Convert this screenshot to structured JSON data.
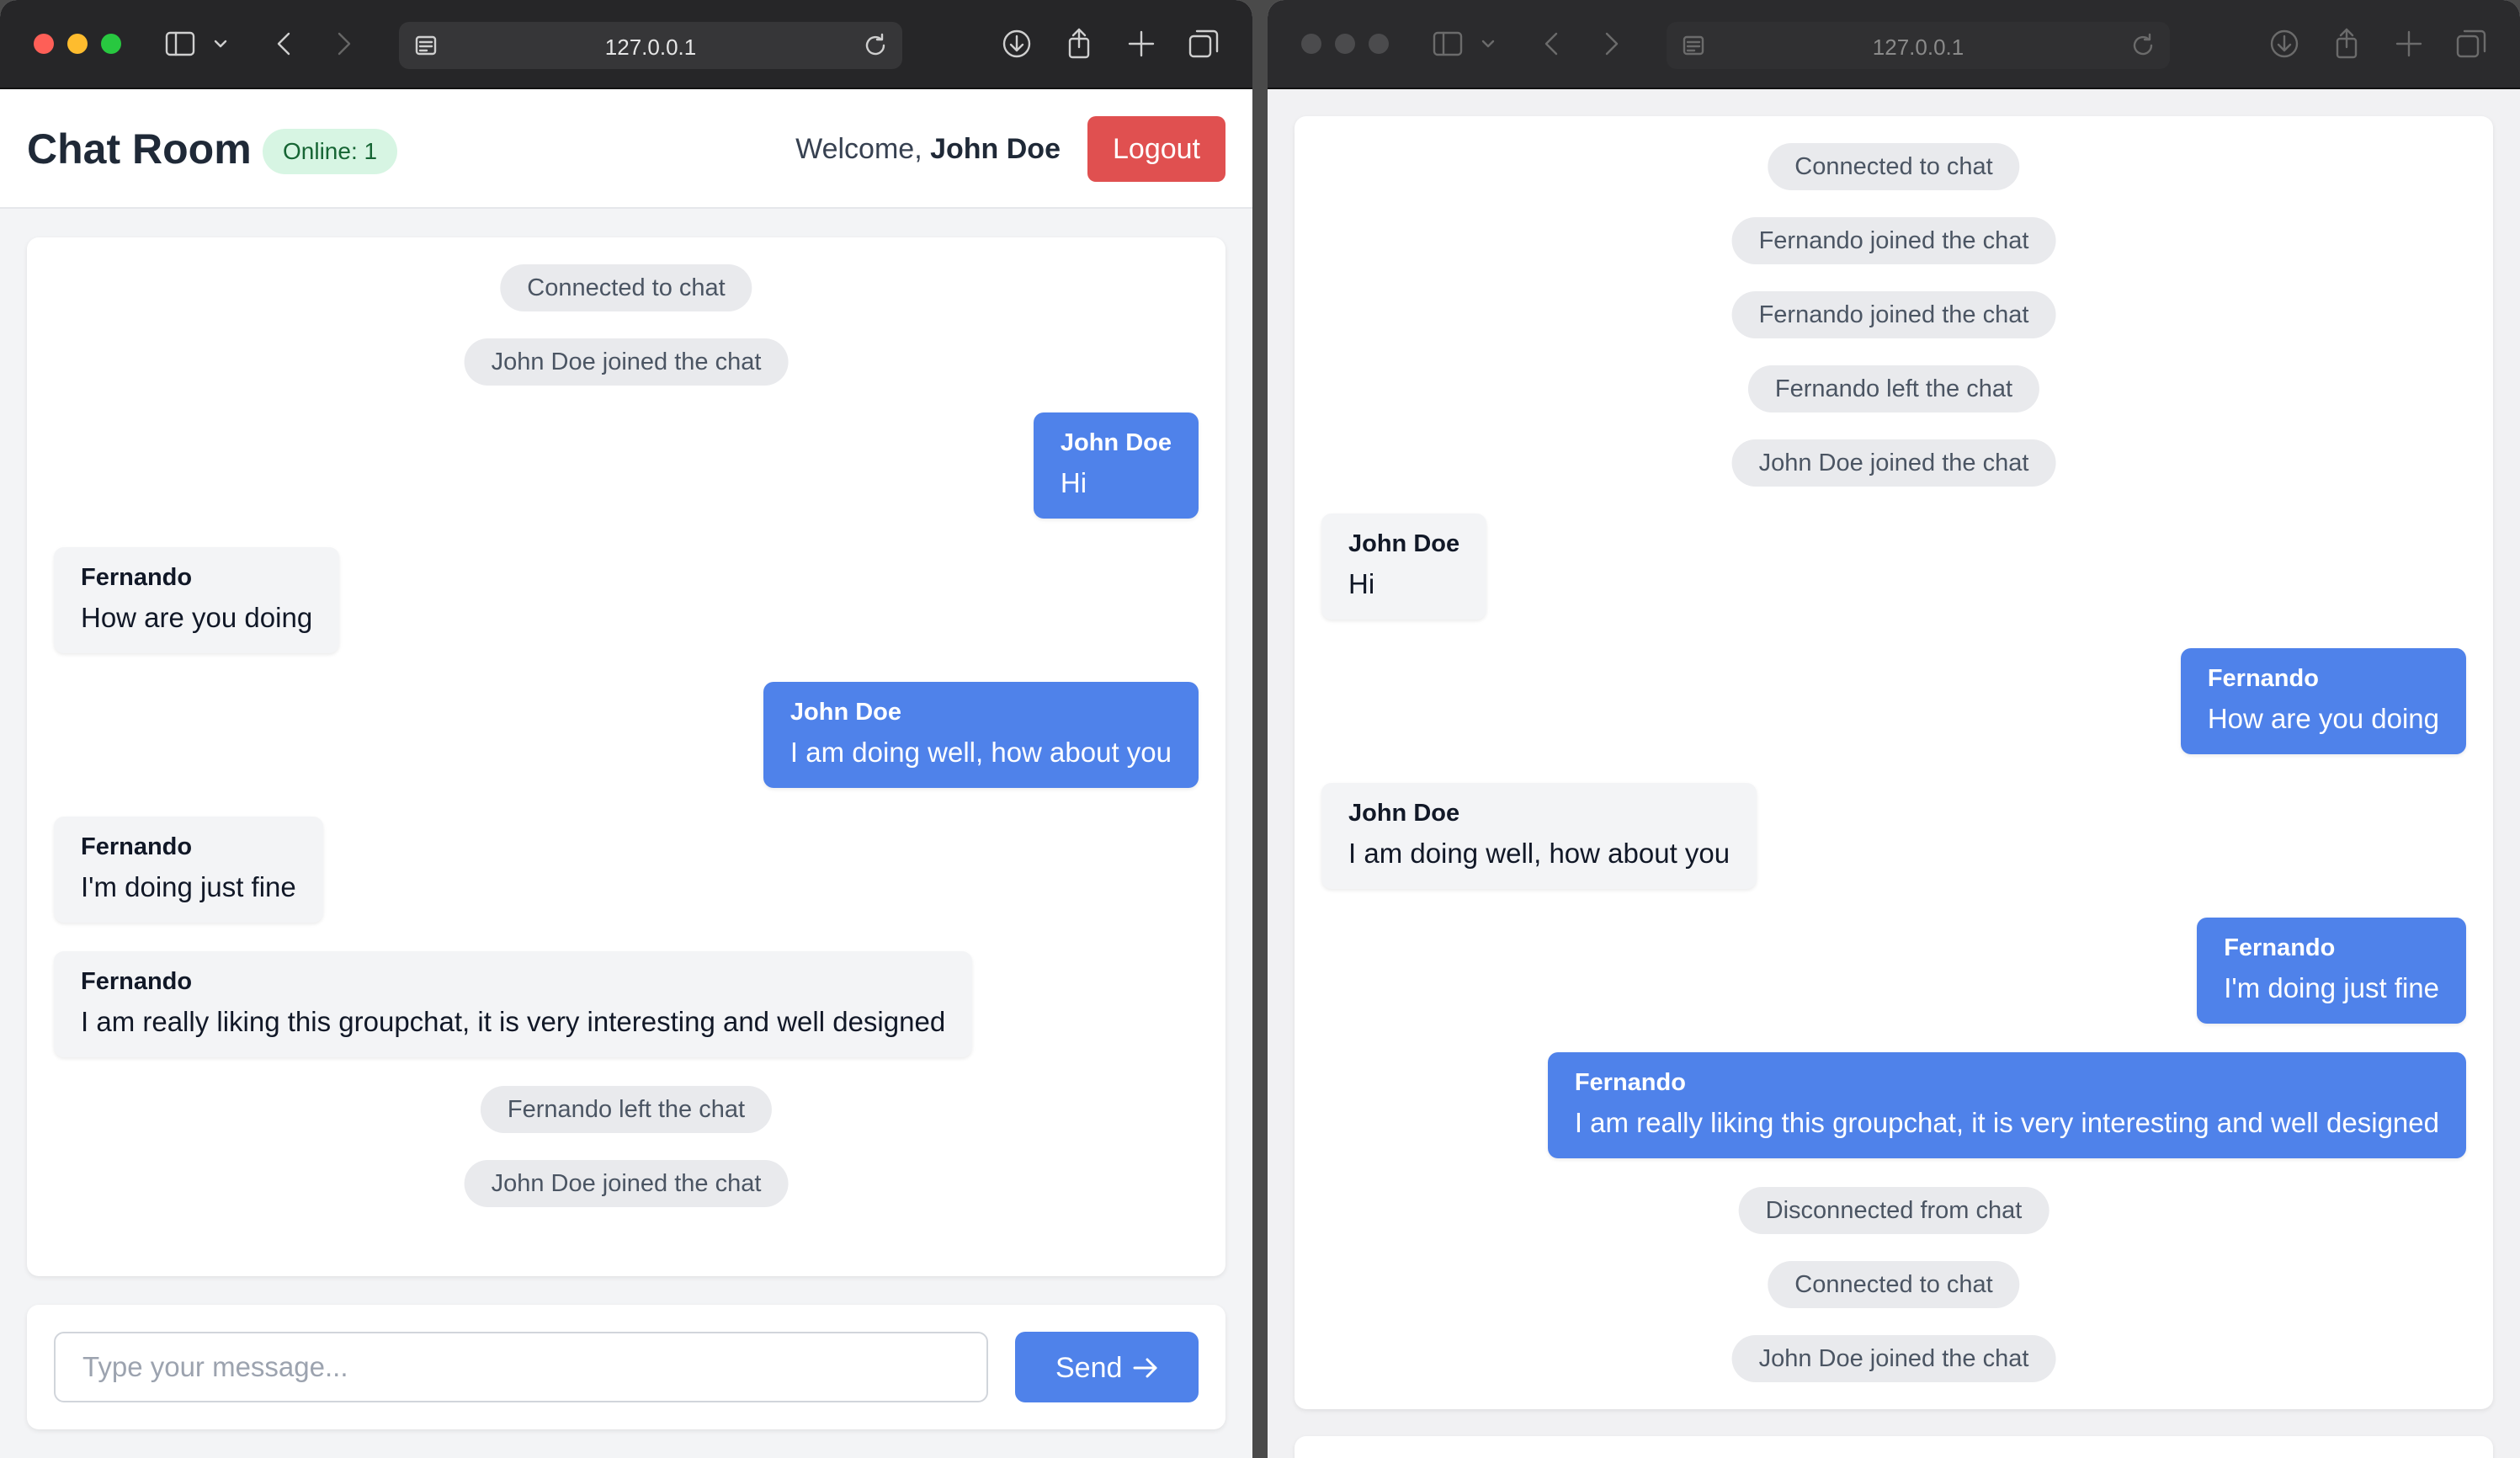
{
  "left_window": {
    "address": "127.0.0.1",
    "header": {
      "title": "Chat Room",
      "online_badge": "Online: 1",
      "welcome_prefix": "Welcome,",
      "welcome_user": "John Doe",
      "logout_label": "Logout"
    },
    "messages": [
      {
        "type": "system",
        "text": "Connected to chat"
      },
      {
        "type": "system",
        "text": "John Doe joined the chat"
      },
      {
        "type": "outgoing",
        "sender": "John Doe",
        "text": "Hi"
      },
      {
        "type": "incoming",
        "sender": "Fernando",
        "text": "How are you doing"
      },
      {
        "type": "outgoing",
        "sender": "John Doe",
        "text": "I am doing well, how about you"
      },
      {
        "type": "incoming",
        "sender": "Fernando",
        "text": "I'm doing just fine"
      },
      {
        "type": "incoming",
        "sender": "Fernando",
        "text": "I am really liking this groupchat, it is very interesting and well designed"
      },
      {
        "type": "system",
        "text": "Fernando left the chat"
      },
      {
        "type": "system",
        "text": "John Doe joined the chat"
      }
    ],
    "composer": {
      "placeholder": "Type your message...",
      "send_label": "Send"
    }
  },
  "right_window": {
    "address": "127.0.0.1",
    "messages": [
      {
        "type": "system",
        "text": "Connected to chat"
      },
      {
        "type": "system",
        "text": "Fernando joined the chat"
      },
      {
        "type": "system",
        "text": "Fernando joined the chat"
      },
      {
        "type": "system",
        "text": "Fernando left the chat"
      },
      {
        "type": "system",
        "text": "John Doe joined the chat"
      },
      {
        "type": "incoming",
        "sender": "John Doe",
        "text": "Hi"
      },
      {
        "type": "outgoing",
        "sender": "Fernando",
        "text": "How are you doing"
      },
      {
        "type": "incoming",
        "sender": "John Doe",
        "text": "I am doing well, how about you"
      },
      {
        "type": "outgoing",
        "sender": "Fernando",
        "text": "I'm doing just fine"
      },
      {
        "type": "outgoing",
        "sender": "Fernando",
        "text": "I am really liking this groupchat, it is very interesting and well designed"
      },
      {
        "type": "system",
        "text": "Disconnected from chat"
      },
      {
        "type": "system",
        "text": "Connected to chat"
      },
      {
        "type": "system",
        "text": "John Doe joined the chat"
      }
    ]
  },
  "colors": {
    "outgoing_bubble": "#4f82ea",
    "incoming_bubble": "#f3f4f6",
    "system_pill": "#e9eaed",
    "logout_button": "#e05050",
    "online_badge_bg": "#d7f5e3",
    "online_badge_text": "#166534"
  }
}
